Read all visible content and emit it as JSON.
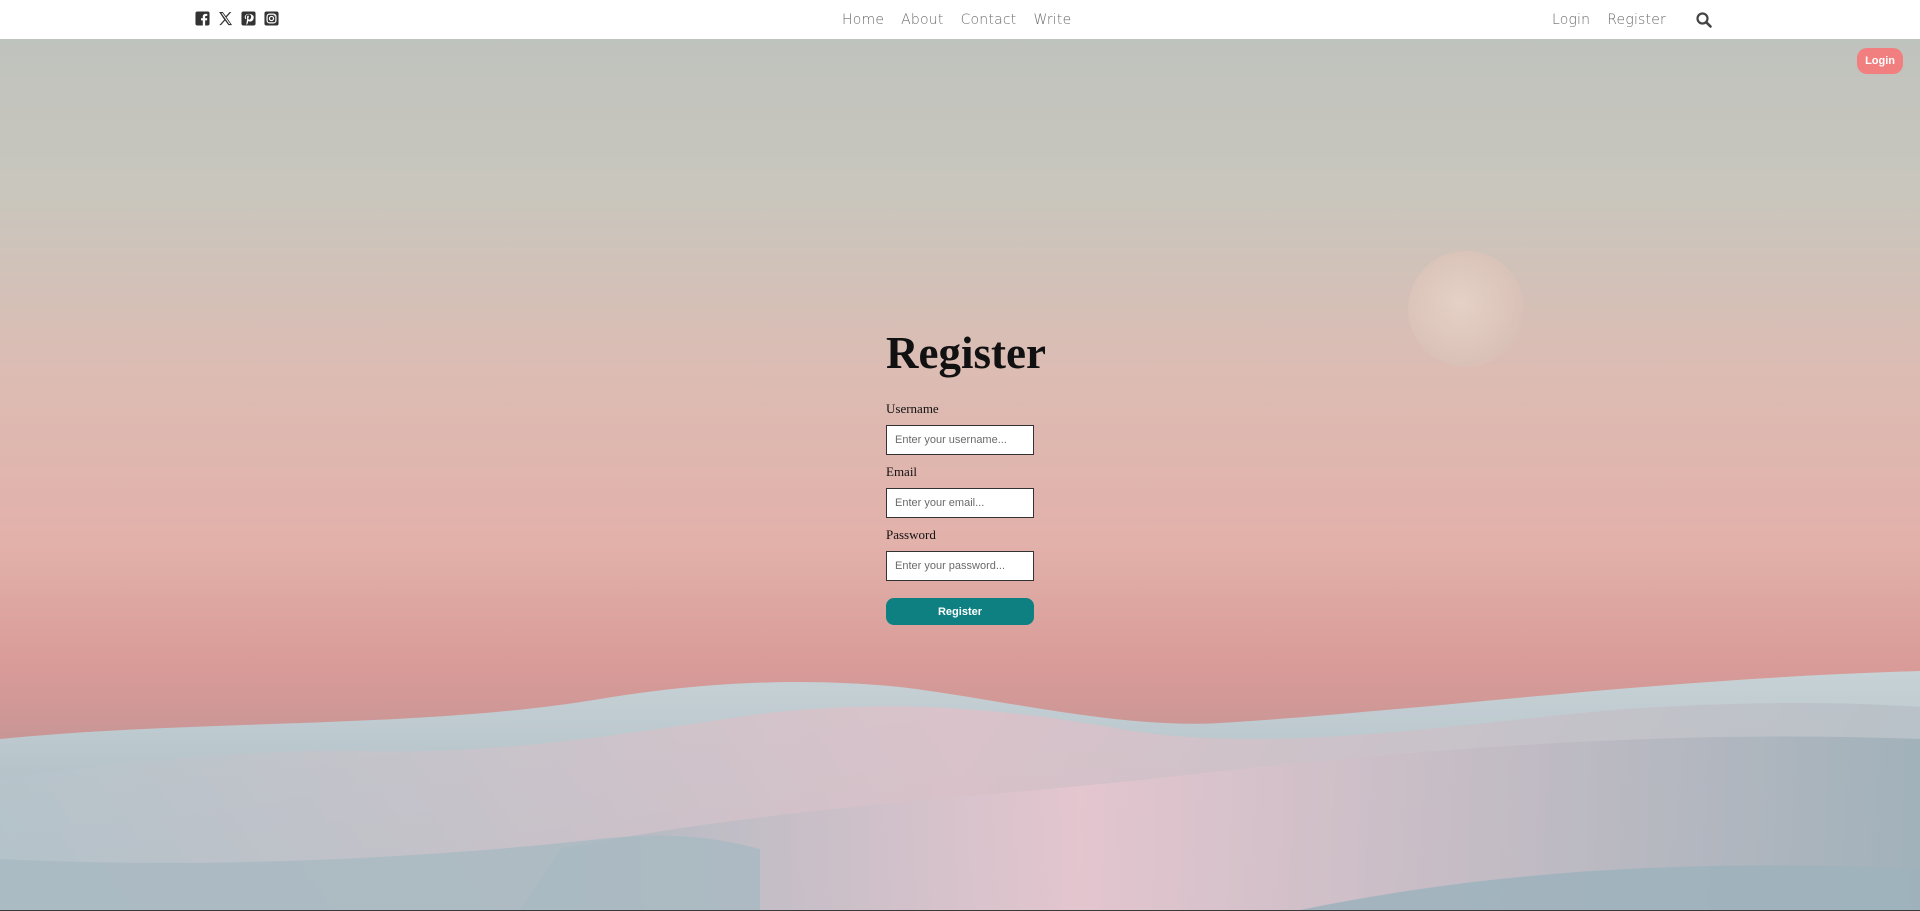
{
  "social": {
    "icons": [
      "facebook-icon",
      "x-twitter-icon",
      "pinterest-icon",
      "instagram-icon"
    ]
  },
  "nav": {
    "center": [
      "Home",
      "About",
      "Contact",
      "Write"
    ],
    "right": [
      "Login",
      "Register"
    ]
  },
  "corner_button": {
    "label": "Login",
    "color": "#f27f7f"
  },
  "form": {
    "title": "Register",
    "username": {
      "label": "Username",
      "placeholder": "Enter your username..."
    },
    "email": {
      "label": "Email",
      "placeholder": "Enter your email..."
    },
    "password": {
      "label": "Password",
      "placeholder": "Enter your password..."
    },
    "submit_label": "Register",
    "submit_color": "#0e8081"
  }
}
